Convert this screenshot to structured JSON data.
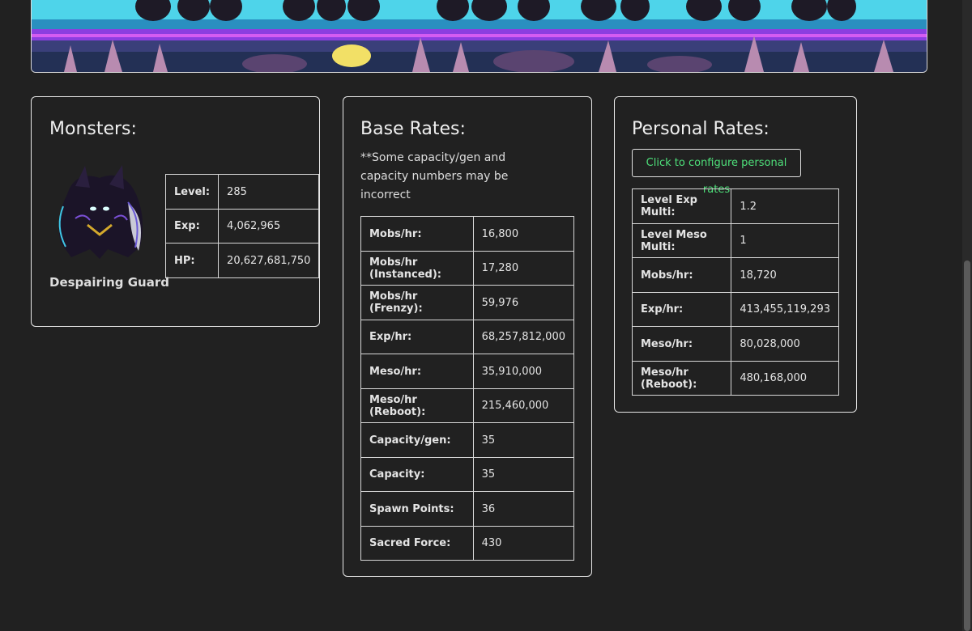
{
  "monsters": {
    "title": "Monsters:",
    "name": "Despairing Guard",
    "stats": [
      {
        "label": "Level:",
        "value": "285"
      },
      {
        "label": "Exp:",
        "value": "4,062,965"
      },
      {
        "label": "HP:",
        "value": "20,627,681,750"
      }
    ]
  },
  "base_rates": {
    "title": "Base Rates:",
    "note": "**Some capacity/gen and capacity numbers may be incorrect",
    "rows": [
      {
        "label": "Mobs/hr:",
        "value": "16,800"
      },
      {
        "label": "Mobs/hr (Instanced):",
        "value": "17,280"
      },
      {
        "label": "Mobs/hr (Frenzy):",
        "value": "59,976"
      },
      {
        "label": "Exp/hr:",
        "value": "68,257,812,000"
      },
      {
        "label": "Meso/hr:",
        "value": "35,910,000"
      },
      {
        "label": "Meso/hr (Reboot):",
        "value": "215,460,000"
      },
      {
        "label": "Capacity/gen:",
        "value": "35"
      },
      {
        "label": "Capacity:",
        "value": "35"
      },
      {
        "label": "Spawn Points:",
        "value": "36"
      },
      {
        "label": "Sacred Force:",
        "value": "430"
      }
    ]
  },
  "personal_rates": {
    "title": "Personal Rates:",
    "button_label": "Click to configure personal rates",
    "rows": [
      {
        "label": "Level Exp Multi:",
        "value": "1.2"
      },
      {
        "label": "Level Meso Multi:",
        "value": "1"
      },
      {
        "label": "Mobs/hr:",
        "value": "18,720"
      },
      {
        "label": "Exp/hr:",
        "value": "413,455,119,293"
      },
      {
        "label": "Meso/hr:",
        "value": "80,028,000"
      },
      {
        "label": "Meso/hr (Reboot):",
        "value": "480,168,000"
      }
    ]
  },
  "colors": {
    "background": "#212121",
    "border": "#e8e8e8",
    "button_text": "#4ee07a"
  }
}
